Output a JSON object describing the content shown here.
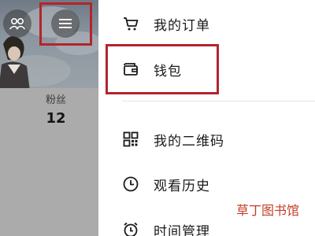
{
  "left_panel": {
    "stats": {
      "followers_label": "粉丝",
      "followers_count": "12"
    }
  },
  "menu": {
    "items": [
      {
        "label": "我的订单",
        "icon": "cart-icon"
      },
      {
        "label": "钱包",
        "icon": "wallet-icon"
      },
      {
        "label": "我的二维码",
        "icon": "qr-code-icon"
      },
      {
        "label": "观看历史",
        "icon": "clock-icon"
      },
      {
        "label": "时间管理",
        "icon": "alarm-clock-icon"
      }
    ]
  },
  "watermark": {
    "part1": "草丁",
    "part2": "图书馆"
  },
  "colors": {
    "highlight": "#b3252b",
    "dim_overlay": "#a9a9a9"
  }
}
